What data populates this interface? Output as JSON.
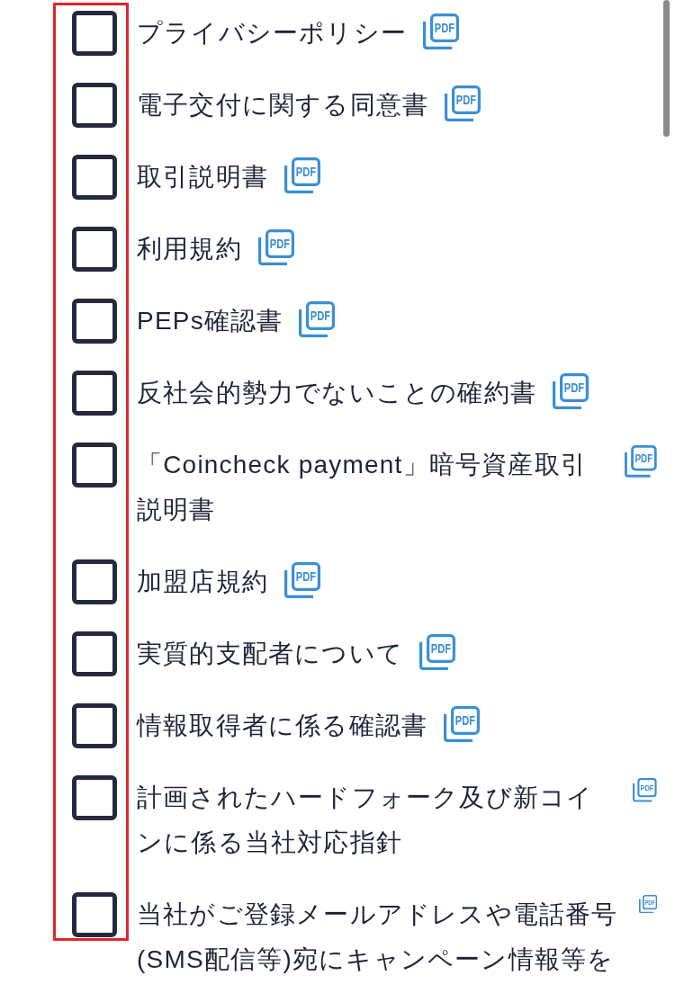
{
  "highlight_checkboxes": true,
  "documents": [
    {
      "label": "プライバシーポリシー",
      "checked": false,
      "file_badge": "PDF"
    },
    {
      "label": "電子交付に関する同意書",
      "checked": false,
      "file_badge": "PDF"
    },
    {
      "label": "取引説明書",
      "checked": false,
      "file_badge": "PDF"
    },
    {
      "label": "利用規約",
      "checked": false,
      "file_badge": "PDF"
    },
    {
      "label": "PEPs確認書",
      "checked": false,
      "file_badge": "PDF"
    },
    {
      "label": "反社会的勢力でないことの確約書",
      "checked": false,
      "file_badge": "PDF"
    },
    {
      "label": "「Coincheck payment」暗号資産取引説明書",
      "checked": false,
      "file_badge": "PDF"
    },
    {
      "label": "加盟店規約",
      "checked": false,
      "file_badge": "PDF"
    },
    {
      "label": "実質的支配者について",
      "checked": false,
      "file_badge": "PDF"
    },
    {
      "label": "情報取得者に係る確認書",
      "checked": false,
      "file_badge": "PDF"
    },
    {
      "label": "計画されたハードフォーク及び新コインに係る当社対応指針",
      "checked": false,
      "file_badge": "PDF"
    },
    {
      "label": "当社がご登録メールアドレスや電話番号(SMS配信等)宛にキャンペーン情報等を",
      "checked": false,
      "file_badge": "PDF"
    }
  ]
}
